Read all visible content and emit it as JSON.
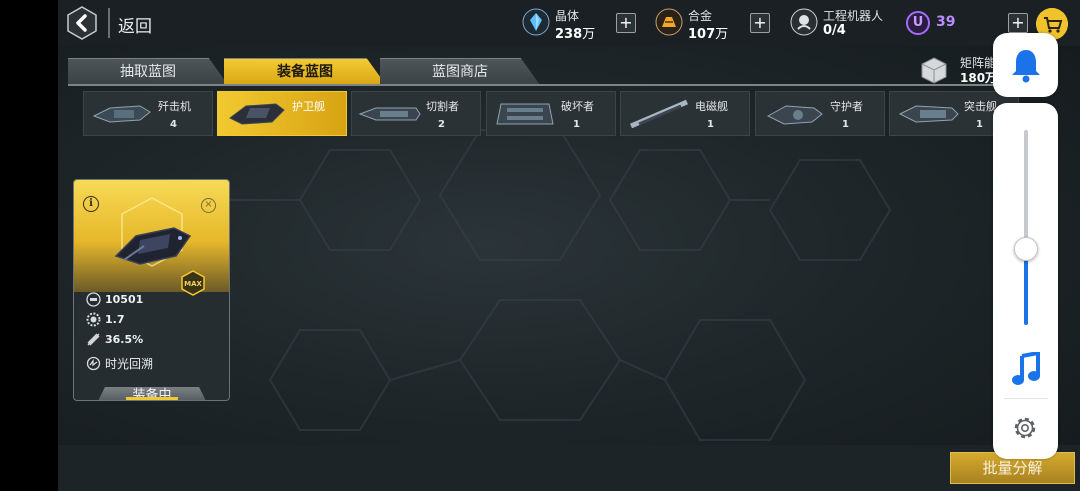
{
  "header": {
    "back_label": "返回",
    "resources": [
      {
        "label": "晶体",
        "value": "238",
        "unit": "万",
        "color": "#4fb4ff",
        "icon": "crystal-icon"
      },
      {
        "label": "合金",
        "value": "107",
        "unit": "万",
        "color": "#f2a62b",
        "icon": "alloy-icon"
      },
      {
        "label": "工程机器人",
        "value": "0/4",
        "unit": "",
        "color": "#d8dcde",
        "icon": "robot-icon"
      }
    ],
    "premium": {
      "symbol": "U",
      "value": "39",
      "color": "#b98cff"
    },
    "plus_symbol": "+"
  },
  "tabs": [
    {
      "label": "抽取蓝图",
      "active": false
    },
    {
      "label": "装备蓝图",
      "active": true
    },
    {
      "label": "蓝图商店",
      "active": false
    }
  ],
  "matrix": {
    "label": "矩阵能",
    "value": "180万"
  },
  "ship_filters": [
    {
      "name": "歼击机",
      "count": "4",
      "active": false
    },
    {
      "name": "护卫舰",
      "count": "",
      "active": true
    },
    {
      "name": "切割者",
      "count": "2",
      "active": false
    },
    {
      "name": "破坏者",
      "count": "1",
      "active": false
    },
    {
      "name": "电磁舰",
      "count": "1",
      "active": false
    },
    {
      "name": "守护者",
      "count": "1",
      "active": false
    },
    {
      "name": "突击舰",
      "count": "1",
      "active": false
    }
  ],
  "card": {
    "info_symbol": "i",
    "close_symbol": "×",
    "max_badge": "MAX",
    "stats": [
      {
        "icon": "helmet-icon",
        "value": "10501"
      },
      {
        "icon": "gear-stat-icon",
        "value": "1.7"
      },
      {
        "icon": "thrust-icon",
        "value": "36.5%"
      },
      {
        "icon": "time-rewind-icon",
        "value": "时光回溯"
      }
    ],
    "equip_label": "装备中"
  },
  "batch_button": "批量分解",
  "colors": {
    "accent": "#f2c930",
    "panel_blue": "#1a73e8"
  }
}
